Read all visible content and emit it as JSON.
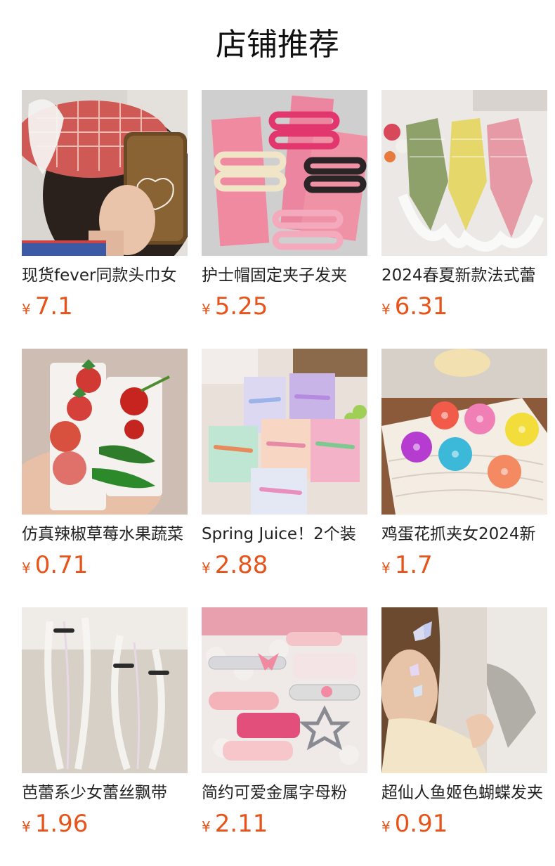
{
  "header": {
    "title": "店铺推荐"
  },
  "currency": "¥",
  "products": [
    {
      "name": "现货fever同款头巾女",
      "price": "7.1",
      "image": "red-gingham-headscarf-photo"
    },
    {
      "name": "护士帽固定夹子发夹",
      "price": "5.25",
      "image": "pink-wavy-hairclips-photo"
    },
    {
      "name": "2024春夏新款法式蕾",
      "price": "6.31",
      "image": "lace-plaid-scarves-photo"
    },
    {
      "name": "仿真辣椒草莓水果蔬菜",
      "price": "0.71",
      "image": "fruit-vegetable-hairclips-photo"
    },
    {
      "name": "Spring Juice！2个装",
      "price": "2.88",
      "image": "pastel-snap-clips-cards-photo"
    },
    {
      "name": "鸡蛋花抓夹女2024新",
      "price": "1.7",
      "image": "frangipani-claw-clips-photo"
    },
    {
      "name": "芭蕾系少女蕾丝飘带",
      "price": "1.96",
      "image": "lace-ribbon-clips-photo"
    },
    {
      "name": "简约可爱金属字母粉",
      "price": "2.11",
      "image": "pink-metal-letter-clips-photo"
    },
    {
      "name": "超仙人鱼姬色蝴蝶发夹",
      "price": "0.91",
      "image": "butterfly-hairclip-model-photo"
    }
  ]
}
